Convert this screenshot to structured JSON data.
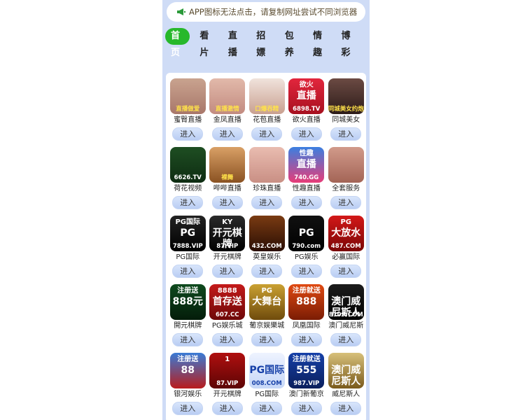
{
  "notice": {
    "text": "APP图标无法点击，请复制网址尝试不同浏览器"
  },
  "nav": [
    "首页",
    "看片",
    "直播",
    "招嫖",
    "包养",
    "情趣",
    "博彩"
  ],
  "enter_label": "进入",
  "colors": {
    "page_bg": "#cfdcf6",
    "active_tab": "#27b82b"
  },
  "apps": [
    {
      "name": "蜜臀直播",
      "bg": "linear-gradient(#c9a38f,#a8776a)",
      "banner": "直播做爱"
    },
    {
      "name": "金凤直播",
      "bg": "linear-gradient(#e2b9aa,#c28b80)",
      "banner": "直播激情"
    },
    {
      "name": "花苞直播",
      "bg": "linear-gradient(#f0e3dc,#c9a090)",
      "banner": "口爆吞精"
    },
    {
      "name": "欲火直播",
      "bg": "linear-gradient(#e2263d,#a7101f)",
      "top": "欲火",
      "mid": "直播",
      "bot": "6898.TV"
    },
    {
      "name": "同城美女",
      "bg": "linear-gradient(#6b4a43,#2d1c19)",
      "banner": "同城美女约炮"
    },
    {
      "name": "荷花视频",
      "bg": "linear-gradient(#1e4e22,#0e2c12)",
      "bot": "6626.TV"
    },
    {
      "name": "哔哔直播",
      "bg": "linear-gradient(#d9a066,#8a5222)",
      "banner": "裸舞"
    },
    {
      "name": "珍珠直播",
      "bg": "linear-gradient(#e9bcb0,#c98f84)"
    },
    {
      "name": "性趣直播",
      "bg": "linear-gradient(#3b7fe0,#e83c78)",
      "top": "性趣",
      "mid": "直播",
      "bot": "740.GG"
    },
    {
      "name": "全套服务",
      "bg": "linear-gradient(#d19a8a,#a36456)"
    },
    {
      "name": "PG国际",
      "bg": "linear-gradient(#222,#000)",
      "top": "PG国际",
      "mid": "PG",
      "bot": "7888.VIP"
    },
    {
      "name": "开元棋牌",
      "bg": "linear-gradient(#2a2a2a,#000)",
      "top": "KY",
      "mid": "开元棋牌",
      "bot": "87.VIP"
    },
    {
      "name": "英皇娱乐",
      "bg": "linear-gradient(#7a3b12,#2a0e04)",
      "bot": "432.COM"
    },
    {
      "name": "PG娱乐",
      "bg": "linear-gradient(#111,#000)",
      "mid": "PG",
      "bot": "790.com"
    },
    {
      "name": "必赢国际",
      "bg": "linear-gradient(#d31818,#7a0606)",
      "top": "PG",
      "mid": "大放水",
      "bot": "487.COM"
    },
    {
      "name": "開元棋牌",
      "bg": "linear-gradient(#0e4a1e,#041c0a)",
      "top": "注册送",
      "mid": "888元"
    },
    {
      "name": "PG娱乐城",
      "bg": "linear-gradient(#c41a1a,#6d0808)",
      "top": "8888",
      "mid": "首存送",
      "bot": "607.CC"
    },
    {
      "name": "葡京娱樂城",
      "bg": "linear-gradient(#caa132,#6f4b0c)",
      "top": "PG",
      "mid": "大舞台"
    },
    {
      "name": "凤凰国际",
      "bg": "linear-gradient(#e04a12,#7a1c04)",
      "top": "注册就送",
      "mid": "888"
    },
    {
      "name": "澳门威尼斯",
      "bg": "linear-gradient(#1c1c1c,#000)",
      "mid": "澳门威尼斯人",
      "bot": "8109.COM"
    },
    {
      "name": "银河娱乐",
      "bg": "linear-gradient(#3a7bd5,#b91c1c)",
      "top": "注册送",
      "mid": "88"
    },
    {
      "name": "开元棋牌",
      "bg": "linear-gradient(#b00f0f,#5c0505)",
      "top": "1",
      "bot": "87.VIP"
    },
    {
      "name": "PG国际",
      "bg": "linear-gradient(#eef3ff,#c6d7f7)",
      "mid": "PG国际",
      "bot": "008.COM",
      "dark": true
    },
    {
      "name": "澳门新葡京",
      "bg": "linear-gradient(#1640a8,#0a1f5c)",
      "top": "注册就送",
      "mid": "555",
      "bot": "987.VIP"
    },
    {
      "name": "威尼斯人",
      "bg": "linear-gradient(#d7c07a,#7a5a1c)",
      "mid": "澳门威尼斯人"
    }
  ]
}
